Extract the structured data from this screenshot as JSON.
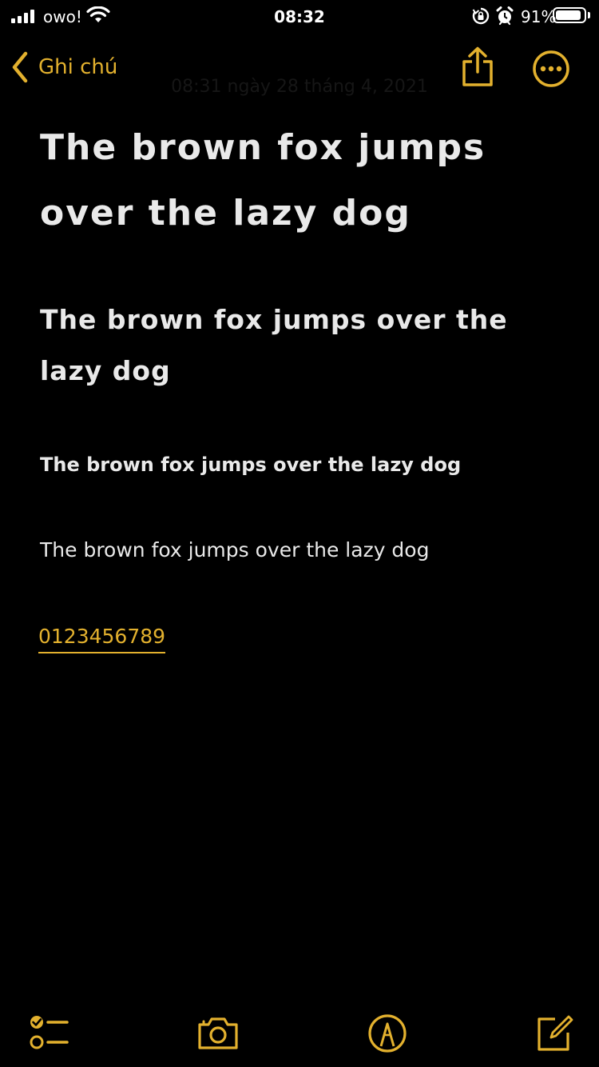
{
  "status_bar": {
    "carrier": "owo!",
    "time": "08:32",
    "battery_percent": "91%",
    "battery_level": 0.91,
    "icons": [
      "signal-icon",
      "wifi-icon",
      "rotation-lock-icon",
      "alarm-icon",
      "battery-icon"
    ]
  },
  "nav": {
    "back_label": "Ghi chú",
    "faded_date": "08:31 ngày 28 tháng 4, 2021",
    "share_icon": "share-icon",
    "more_icon": "more-icon"
  },
  "note": {
    "heading_1": "The brown fox jumps over the lazy dog",
    "heading_2": "The brown fox jumps over the lazy dog",
    "heading_3": "The brown fox jumps over the lazy dog",
    "body": "The brown fox jumps over the lazy dog",
    "number_link": "0123456789"
  },
  "toolbar": {
    "items": [
      "checklist-icon",
      "camera-icon",
      "markup-icon",
      "compose-icon"
    ]
  },
  "colors": {
    "accent": "#e3b12e",
    "background": "#000000",
    "text": "#e9e9e9"
  }
}
